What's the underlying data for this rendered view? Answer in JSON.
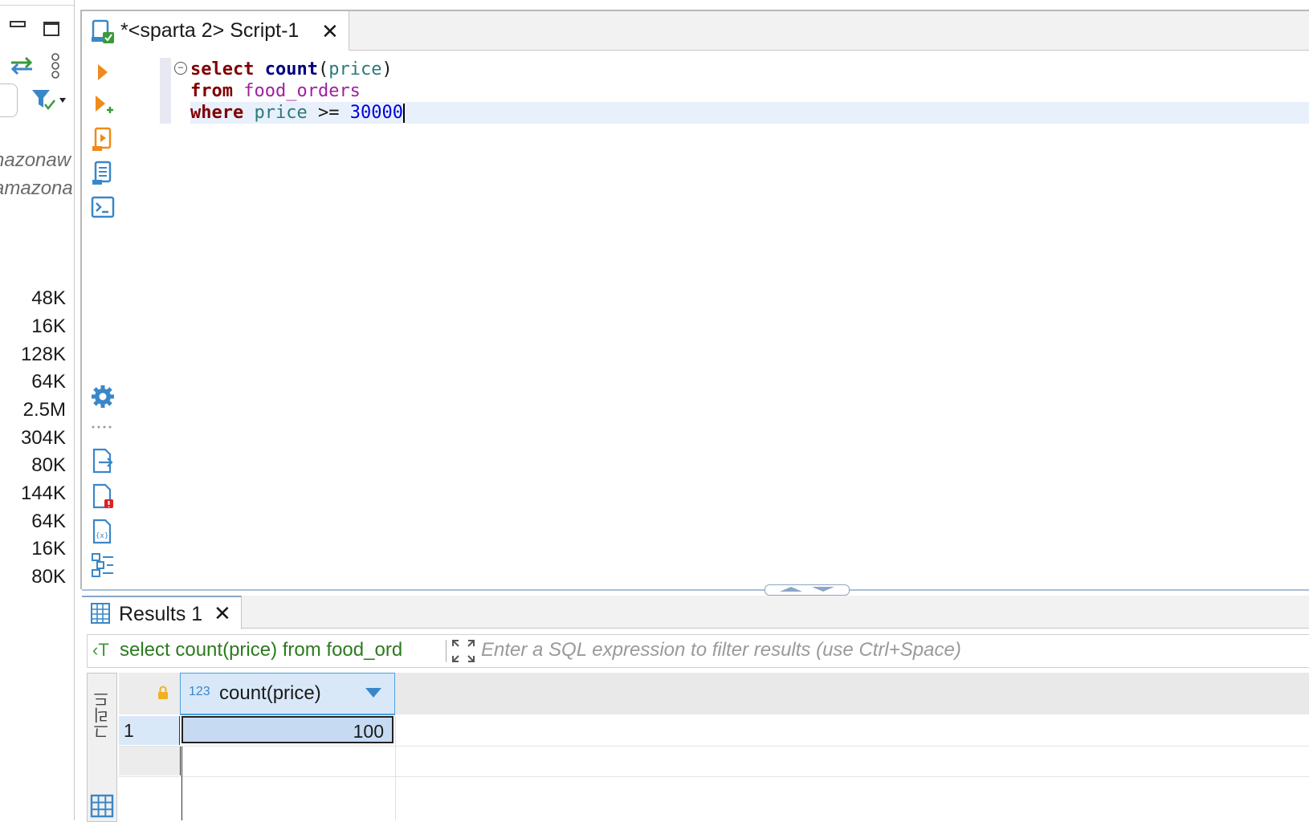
{
  "navigator": {
    "db_items": [
      "nazonaw",
      "amazona"
    ],
    "sizes": [
      "48K",
      "16K",
      "128K",
      "64K",
      "2.5M",
      "304K",
      "80K",
      "144K",
      "64K",
      "16K",
      "80K"
    ]
  },
  "editor": {
    "tab_title": "*<sparta 2> Script-1",
    "code": {
      "line1": {
        "kw": "select",
        "fn": "count",
        "open": "(",
        "arg": "price",
        "close": ")"
      },
      "line2": {
        "kw": "from",
        "table": "food_orders"
      },
      "line3": {
        "kw": "where",
        "col": "price",
        "op": ">=",
        "num": "30000"
      }
    }
  },
  "results": {
    "tab_title": "Results 1",
    "query_text": "select count(price) from food_ord",
    "filter_placeholder": "Enter a SQL expression to filter results (use Ctrl+Space)",
    "side_tab": "그리드",
    "columns": [
      {
        "type": "123",
        "name": "count(price)"
      }
    ],
    "rows": [
      {
        "num": "1",
        "values": [
          "100"
        ]
      }
    ]
  },
  "colors": {
    "keyword": "#7f0000",
    "function": "#00007f",
    "identifier": "#2a7a7a",
    "table": "#a020a0",
    "number": "#0000e0",
    "query_text": "#2d7a1f",
    "selection": "#c6daf2"
  }
}
